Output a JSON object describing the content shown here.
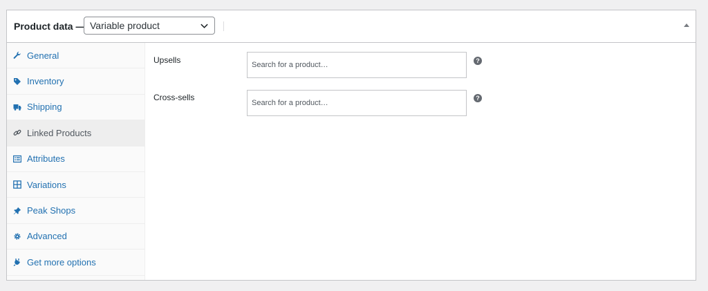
{
  "header": {
    "title": "Product data —",
    "product_type": "Variable product"
  },
  "tabs": [
    {
      "label": "General",
      "icon": "wrench-icon"
    },
    {
      "label": "Inventory",
      "icon": "tag-icon"
    },
    {
      "label": "Shipping",
      "icon": "truck-icon"
    },
    {
      "label": "Linked Products",
      "icon": "link-icon",
      "active": true
    },
    {
      "label": "Attributes",
      "icon": "list-icon"
    },
    {
      "label": "Variations",
      "icon": "grid-icon"
    },
    {
      "label": "Peak Shops",
      "icon": "pin-icon"
    },
    {
      "label": "Advanced",
      "icon": "gear-icon"
    },
    {
      "label": "Get more options",
      "icon": "plugin-icon"
    }
  ],
  "fields": {
    "upsells": {
      "label": "Upsells",
      "placeholder": "Search for a product…"
    },
    "cross_sells": {
      "label": "Cross-sells",
      "placeholder": "Search for a product…"
    }
  },
  "colors": {
    "link": "#2271b1",
    "border": "#c3c4c7",
    "active_tab_bg": "#eeeeee"
  }
}
